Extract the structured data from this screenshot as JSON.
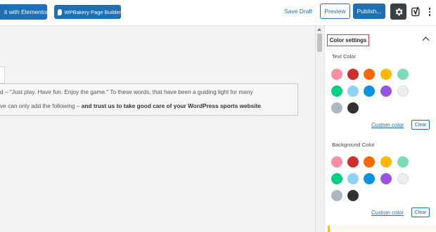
{
  "toolbar": {
    "elementor_label": "it with Elementor",
    "wpbakery_label": "WPBakery Page Builder",
    "save_draft_label": "Save Draft",
    "preview_label": "Preview",
    "publish_label": "Publish..."
  },
  "editor": {
    "line1": "d – \"Just play. Have fun. Enjoy the game.\" To these words, that have been a guiding light for many",
    "line2_prefix": "ve can only add the following – ",
    "line2_bold": "and trust us to take good care of your WordPress sports website",
    "line2_suffix": "."
  },
  "sidebar": {
    "panel_title": "Color settings",
    "text_color": {
      "label": "Text Color",
      "custom_label": "Custom color",
      "clear_label": "Clear"
    },
    "background_color": {
      "label": "Background Color",
      "custom_label": "Custom color",
      "clear_label": "Clear"
    }
  },
  "palette": [
    "#f78da7",
    "#cf2e2e",
    "#ff6900",
    "#fcb900",
    "#7bdcb5",
    "#00d084",
    "#8ed1fc",
    "#0693e3",
    "#9b51e0",
    "#eeeeee",
    "#abb8c3",
    "#313131"
  ],
  "colors": {
    "accent": "#1e6fb3",
    "panel_highlight": "#d63a5f",
    "settings_button": "#3a3f44"
  },
  "icons": {
    "settings": "gear-icon",
    "yoast": "yoast-icon",
    "more": "more-vertical-icon",
    "wpbakery": "wpbakery-logo-icon",
    "collapse": "chevron-up-icon"
  }
}
